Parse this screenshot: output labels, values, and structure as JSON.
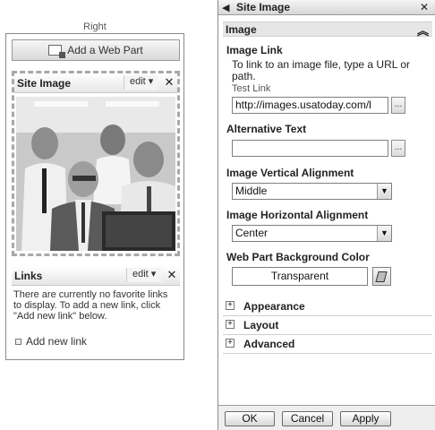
{
  "zone": {
    "title": "Right",
    "add_web_part": "Add a Web Part"
  },
  "site_image_part": {
    "title": "Site Image",
    "edit_label": "edit ▾",
    "close_label": "✕"
  },
  "links_part": {
    "title": "Links",
    "edit_label": "edit ▾",
    "close_label": "✕",
    "body": "There are currently no favorite links to display. To add a new link, click \"Add new link\" below.",
    "add_link": "Add new link"
  },
  "tool_pane": {
    "title": "Site Image",
    "close_label": "✕",
    "section_title": "Image",
    "image_link": {
      "label": "Image Link",
      "description": "To link to an image file, type a URL or path.",
      "test_link": "Test Link",
      "value": "http://images.usatoday.com/l",
      "builder_label": "..."
    },
    "alt_text": {
      "label": "Alternative Text",
      "value": "",
      "builder_label": "..."
    },
    "vertical_alignment": {
      "label": "Image Vertical Alignment",
      "value": "Middle"
    },
    "horizontal_alignment": {
      "label": "Image Horizontal Alignment",
      "value": "Center"
    },
    "background_color": {
      "label": "Web Part Background Color",
      "value": "Transparent"
    },
    "collapsed_sections": [
      "Appearance",
      "Layout",
      "Advanced"
    ],
    "buttons": {
      "ok": "OK",
      "cancel": "Cancel",
      "apply": "Apply"
    }
  }
}
